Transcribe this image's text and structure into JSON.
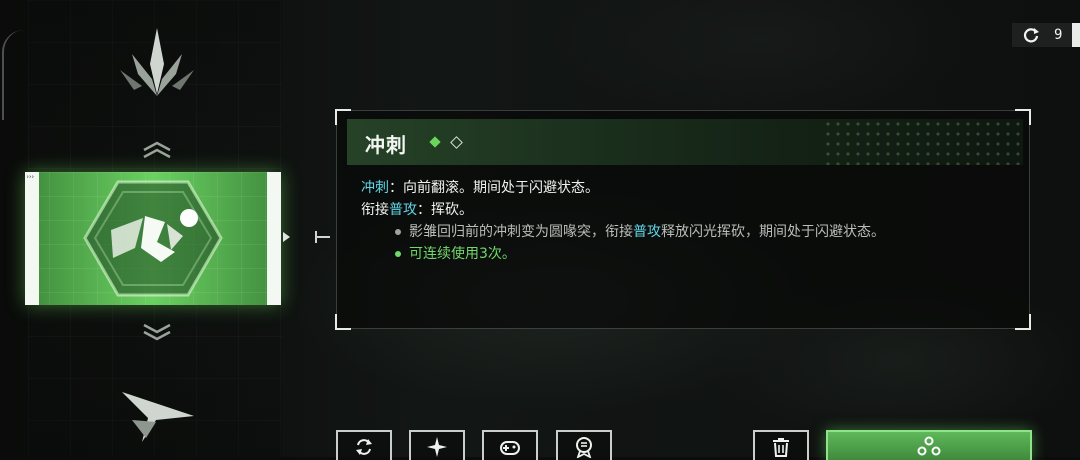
{
  "counter": {
    "icon": "refresh-icon",
    "value": "9"
  },
  "skill_list": {
    "top_icon": "claw-dive-icon",
    "bottom_icon": "lightning-dash-icon",
    "selected_icon": "running-sprint-icon",
    "accent": "#6bd162"
  },
  "detail": {
    "title": "冲刺",
    "line1_kw": "冲刺",
    "line1_text": "：向前翻滚。期间处于闪避状态。",
    "line2_pre": "衔接",
    "line2_kw": "普攻",
    "line2_text": "：挥砍。",
    "sub1_pre": "影雏回归前的冲刺变为圆喙突，衔接",
    "sub1_kw": "普攻",
    "sub1_post": "释放闪光挥砍，期间处于闪避状态。",
    "sub2": "可连续使用3次。"
  },
  "colors": {
    "keyword": "#5fd6e6",
    "highlight": "#72d86a",
    "subtext": "#b9beb9"
  },
  "bottom_buttons": [
    "swap-icon",
    "sparkle-icon",
    "gamepad-icon",
    "medal-icon",
    "trash-icon"
  ],
  "confirm_icon": "cluster-icon"
}
